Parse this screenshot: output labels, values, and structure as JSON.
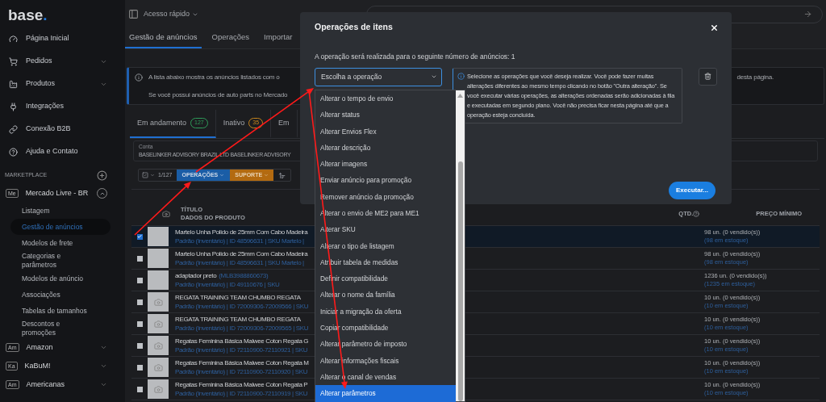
{
  "sidebar": {
    "logo": {
      "word": "base",
      "dot": "."
    },
    "nav": [
      {
        "label": "Página Inicial",
        "has_submenu": false
      },
      {
        "label": "Pedidos",
        "has_submenu": true
      },
      {
        "label": "Produtos",
        "has_submenu": true
      },
      {
        "label": "Integrações",
        "has_submenu": false
      },
      {
        "label": "Conexão B2B",
        "has_submenu": false
      },
      {
        "label": "Ajuda e Contato",
        "has_submenu": false
      }
    ],
    "section_title": "MARKETPLACE",
    "marketplaces": [
      {
        "badge": "Me",
        "name": "Mercado Livre - BR",
        "expanded": true,
        "children": [
          {
            "label": "Listagem",
            "selected": false
          },
          {
            "label": "Gestão de anúncios",
            "selected": true
          },
          {
            "label": "Modelos de frete",
            "selected": false
          },
          {
            "label": "Categorias e parâmetros",
            "selected": false
          },
          {
            "label": "Modelos de anúncio",
            "selected": false
          },
          {
            "label": "Associações",
            "selected": false
          },
          {
            "label": "Tabelas de tamanhos",
            "selected": false
          },
          {
            "label": "Descontos e promoções",
            "selected": false
          }
        ]
      },
      {
        "badge": "Am",
        "name": "Amazon",
        "expanded": false
      },
      {
        "badge": "Ka",
        "name": "KaBuM!",
        "expanded": false
      },
      {
        "badge": "Am",
        "name": "Americanas",
        "expanded": false
      }
    ]
  },
  "topbar": {
    "quick_access": "Acesso rápido"
  },
  "subnav": [
    {
      "label": "Gestão de anúncios",
      "selected": true
    },
    {
      "label": "Operações",
      "selected": false
    },
    {
      "label": "Importar",
      "selected": false
    }
  ],
  "notice": {
    "line_1": "A lista abaixo mostra os anúncios listados com o",
    "line_1_end": "desta página.",
    "line_2": "Se você possui anúncios de auto parts no Mercado"
  },
  "status_tabs": [
    {
      "label": "Em andamento",
      "count": "127",
      "color": "#2f9d5a",
      "selected": true
    },
    {
      "label": "Inativo",
      "count": "35",
      "color": "#c8861c",
      "selected": false
    },
    {
      "label": "Em",
      "selected": false
    }
  ],
  "account_field": {
    "label": "Conta",
    "value": "BASELINKER ADVISORY BRAZIL LTD BASELINKER ADVISORY"
  },
  "toolbar": {
    "selection": "1/127",
    "operations": "OPERAÇÕES",
    "support": "SUPORTE"
  },
  "table": {
    "columns": [
      "TÍTULO",
      "DADOS DO PRODUTO",
      "QTD.",
      "PREÇO MÍNIMO"
    ],
    "rows": [
      {
        "checked": true,
        "kind": "photo",
        "title": "Martelo Unha Polido de 25mm Com Cabo Madeira",
        "details": "Padrão (Inventário) | ID 48596631 | SKU Martelo |",
        "qty": "98 un. (0 vendido(s))",
        "stock": "(98 em estoque)"
      },
      {
        "checked": false,
        "kind": "photo",
        "title": "Martelo Unha Polido de 25mm Com Cabo Madeira",
        "details": "Padrão (Inventário) | ID 48596631 | SKU Martelo |",
        "qty": "98 un. (0 vendido(s))",
        "stock": "(98 em estoque)"
      },
      {
        "checked": false,
        "kind": "photo",
        "title": "adaptador preto",
        "code": "(MLB3988860673)",
        "details": "Padrão (Inventário) | ID 49110676 | SKU",
        "qty": "1236 un. (0 vendido(s))",
        "stock": "(1235 em estoque)"
      },
      {
        "checked": false,
        "kind": "no_photo",
        "title": "REGATA TRAINING TEAM CHUMBO REGATA",
        "details": "Padrão (Inventário) | ID 72009306-72009566 | SKU",
        "qty": "10 un. (0 vendido(s))",
        "stock": "(10 em estoque)"
      },
      {
        "checked": false,
        "kind": "no_photo",
        "title": "REGATA TRAINING TEAM CHUMBO REGATA",
        "details": "Padrão (Inventário) | ID 72009306-72009565 | SKU",
        "qty": "10 un. (0 vendido(s))",
        "stock": "(10 em estoque)"
      },
      {
        "checked": false,
        "kind": "no_photo",
        "title": "Regatas Feminina Básica Malwee Coton Regata G",
        "details": "Padrão (Inventário) | ID 72110900-72110921 | SKU",
        "qty": "10 un. (0 vendido(s))",
        "stock": "(10 em estoque)"
      },
      {
        "checked": false,
        "kind": "no_photo",
        "title": "Regatas Feminina Básica Malwee Coton Regata M",
        "details": "Padrão (Inventário) | ID 72110900-72110920 | SKU",
        "qty": "10 un. (0 vendido(s))",
        "stock": "(10 em estoque)"
      },
      {
        "checked": false,
        "kind": "no_photo",
        "title": "Regatas Feminina Básica Malwee Coton Regata P",
        "details": "Padrão (Inventário) | ID 72110900-72110919 | SKU",
        "qty": "10 un. (0 vendido(s))",
        "stock": "(10 em estoque)"
      }
    ]
  },
  "modal": {
    "title": "Operações de itens",
    "count_text": "A operação será realizada para o seguinte número de anúncios: 1",
    "select": {
      "placeholder": "Escolha a operação",
      "options": [
        {
          "label": "Alterar o tempo de envio",
          "selected": false
        },
        {
          "label": "Alterar status",
          "selected": false
        },
        {
          "label": "Alterar Envios Flex",
          "selected": false
        },
        {
          "label": "Alterar descrição",
          "selected": false
        },
        {
          "label": "Alterar imagens",
          "selected": false
        },
        {
          "label": "Enviar anúncio para promoção",
          "selected": false
        },
        {
          "label": "Remover anúncio da promoção",
          "selected": false
        },
        {
          "label": "Alterar o envio de ME2 para ME1",
          "selected": false
        },
        {
          "label": "Alterar SKU",
          "selected": false
        },
        {
          "label": "Alterar o tipo de listagem",
          "selected": false
        },
        {
          "label": "Atribuir tabela de medidas",
          "selected": false
        },
        {
          "label": "Definir compatibilidade",
          "selected": false
        },
        {
          "label": "Alterar o nome da família",
          "selected": false
        },
        {
          "label": "Iniciar a migração da oferta",
          "selected": false
        },
        {
          "label": "Copiar compatibilidade",
          "selected": false
        },
        {
          "label": "Alterar parâmetro de imposto",
          "selected": false
        },
        {
          "label": "Alterar informações fiscais",
          "selected": false
        },
        {
          "label": "Alterar o canal de vendas",
          "selected": false
        },
        {
          "label": "Alterar parâmetros",
          "selected": true
        }
      ]
    },
    "info": "Selecione as operações que você deseja realizar. Você pode fazer muitas alterações diferentes ao mesmo tempo clicando no botão \"Outra alteração\". Se você executar várias operações, as alterações ordenadas serão adicionadas à fila e executadas em segundo plano. Você não precisa ficar nesta página até que a operação esteja concluída.",
    "execute_button": "Executar..."
  }
}
